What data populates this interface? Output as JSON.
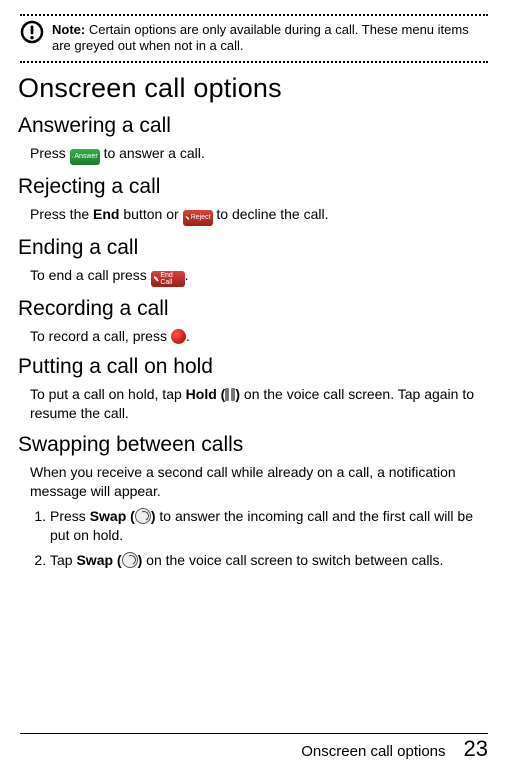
{
  "note": {
    "label": "Note:",
    "text": "Certain options are only available during a call. These menu items are greyed out when not in a call."
  },
  "h1": "Onscreen call options",
  "answer": {
    "heading": "Answering a call",
    "pre": "Press ",
    "btn_label": "Answer",
    "post": " to answer a call."
  },
  "reject": {
    "heading": "Rejecting a call",
    "pre": "Press the ",
    "end_word": "End",
    "mid": " button or ",
    "btn_label": "Reject",
    "post": " to decline the call."
  },
  "ending": {
    "heading": "Ending a call",
    "pre": "To end a call press ",
    "btn_label": "End Call",
    "post": "."
  },
  "recording": {
    "heading": "Recording a call",
    "pre": "To record a call, press ",
    "post": "."
  },
  "hold": {
    "heading": "Putting a call on hold",
    "pre": "To put a call on hold, tap ",
    "hold_word": "Hold",
    "open": " (",
    "close": ")",
    "post": " on the voice call screen. Tap again to resume the call."
  },
  "swap": {
    "heading": "Swapping between calls",
    "intro": "When you receive a second call while already on a call, a notification message will appear.",
    "step1_a": "Press ",
    "swap_word": "Swap",
    "open": " (",
    "close": ")",
    "step1_b": " to answer the incoming call and the first call will be put on hold.",
    "step2_a": "Tap ",
    "step2_b": " on the voice call screen to switch between calls."
  },
  "footer": {
    "title": "Onscreen call options",
    "page": "23"
  }
}
